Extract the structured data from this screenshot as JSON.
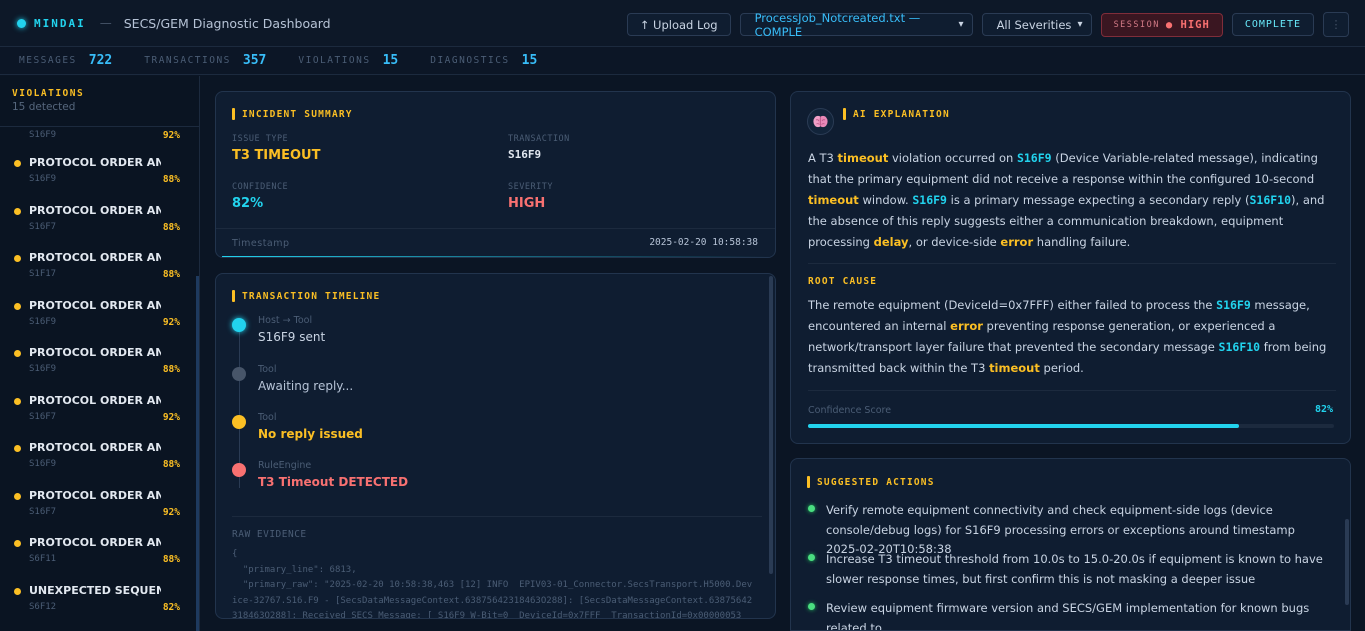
{
  "header": {
    "brand": "MINDAI",
    "separator": "—",
    "title": "SECS/GEM Diagnostic Dashboard",
    "upload_label": "↑ Upload Log",
    "file_select": "ProcessJob_Notcreated.txt — COMPLE",
    "severity_select": "All Severities",
    "session_label": "SESSION",
    "session_value": "● HIGH",
    "complete_label": "COMPLETE",
    "accent_color": "#22d3ee"
  },
  "stats": [
    {
      "label": "MESSAGES",
      "value": "722"
    },
    {
      "label": "TRANSACTIONS",
      "value": "357"
    },
    {
      "label": "VIOLATIONS",
      "value": "15"
    },
    {
      "label": "DIAGNOSTICS",
      "value": "15"
    }
  ],
  "sidebar": {
    "title": "VIOLATIONS",
    "subtitle": "15 detected",
    "partial": {
      "code": "S16F9",
      "pct": "92%"
    },
    "items": [
      {
        "label": "PROTOCOL ORDER AN...",
        "code": "S16F9",
        "pct": "88%"
      },
      {
        "label": "PROTOCOL ORDER AN...",
        "code": "S16F7",
        "pct": "88%"
      },
      {
        "label": "PROTOCOL ORDER AN...",
        "code": "S1F17",
        "pct": "88%"
      },
      {
        "label": "PROTOCOL ORDER AN...",
        "code": "S16F9",
        "pct": "92%"
      },
      {
        "label": "PROTOCOL ORDER AN...",
        "code": "S16F9",
        "pct": "88%"
      },
      {
        "label": "PROTOCOL ORDER AN...",
        "code": "S16F7",
        "pct": "92%"
      },
      {
        "label": "PROTOCOL ORDER AN...",
        "code": "S16F9",
        "pct": "88%"
      },
      {
        "label": "PROTOCOL ORDER AN...",
        "code": "S16F7",
        "pct": "92%"
      },
      {
        "label": "PROTOCOL ORDER AN...",
        "code": "S6F11",
        "pct": "88%"
      },
      {
        "label": "UNEXPECTED SEQUEN...",
        "code": "S6F12",
        "pct": "82%"
      }
    ]
  },
  "incident": {
    "title": "INCIDENT SUMMARY",
    "issue_type_label": "ISSUE TYPE",
    "issue_type": "T3 TIMEOUT",
    "transaction_label": "TRANSACTION",
    "transaction": "S16F9",
    "confidence_label": "CONFIDENCE",
    "confidence": "82%",
    "severity_label": "SEVERITY",
    "severity": "HIGH",
    "timestamp_label": "Timestamp",
    "timestamp": "2025-02-20 10:58:38"
  },
  "timeline": {
    "title": "TRANSACTION TIMELINE",
    "steps": [
      {
        "actor": "Host → Tool",
        "text": "S16F9 sent",
        "color": "#22d3ee"
      },
      {
        "actor": "Tool",
        "text": "Awaiting reply...",
        "color": "#475569"
      },
      {
        "actor": "Tool",
        "text": "No reply issued",
        "color": "#fbbf24"
      },
      {
        "actor": "RuleEngine",
        "text": "T3 Timeout DETECTED",
        "color": "#f87171"
      }
    ],
    "raw_label": "RAW EVIDENCE",
    "raw_lines": [
      "{",
      "  \"primary_line\": 6813,",
      "  \"primary_raw\": \"2025-02-20 10:58:38,463 [12] INFO  EPIV03-01_Connector.SecsTransport.H5000.Dev",
      "ice-32767.S16.F9 - [SecsDataMessageContext.63875642318463O288]: [SecsDataMessageContext.63875642",
      "318463O288]: Received SECS Message: [ S16F9 W-Bit=0  DeviceId=0x7FFF  TransactionId=0x00000053"
    ]
  },
  "ai": {
    "title": "AI EXPLANATION",
    "root_cause_title": "ROOT CAUSE",
    "confidence_label": "Confidence Score",
    "confidence_value": "82%",
    "confidence_fraction": 0.82
  },
  "actions": {
    "title": "SUGGESTED ACTIONS",
    "items": [
      "Verify remote equipment connectivity and check equipment-side logs (device console/debug logs) for S16F9 processing errors or exceptions around timestamp 2025-02-20T10:58:38",
      "Increase T3 timeout threshold from 10.0s to 15.0-20.0s if equipment is known to have slower response times, but first confirm this is not masking a deeper issue",
      "Review equipment firmware version and SECS/GEM implementation for known bugs related to"
    ]
  }
}
